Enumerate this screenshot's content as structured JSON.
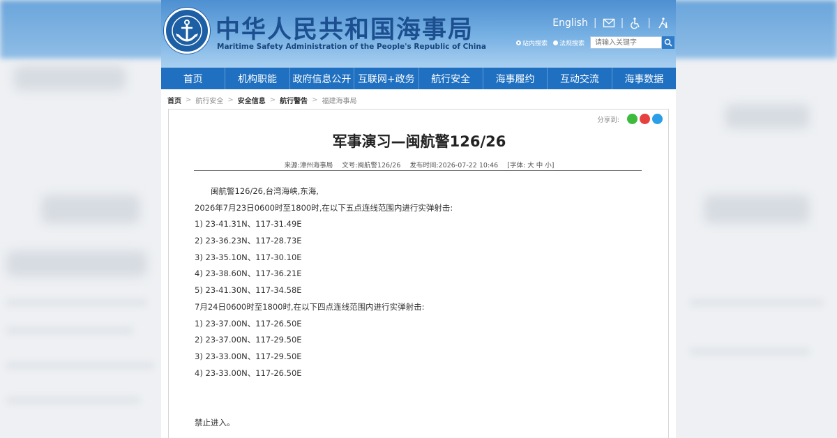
{
  "colors": {
    "brand_blue": "#1f70c1",
    "header_top": "#4d8fd1",
    "header_bottom": "#a9cff0",
    "title_navy": "#1c4f8f"
  },
  "header": {
    "logo_icon": "anchor-emblem-icon",
    "title": "中华人民共和国海事局",
    "subtitle": "Maritime Safety Administration of the People's Republic of China",
    "english_link": "English",
    "icons": [
      "mail-icon",
      "accessibility-icon",
      "elder-mode-icon"
    ]
  },
  "search": {
    "option_site": "站内搜索",
    "option_regs": "法规搜索",
    "placeholder": "请输入关键字",
    "button_icon": "search-icon"
  },
  "nav": {
    "items": [
      "首页",
      "机构职能",
      "政府信息公开",
      "互联网+政务",
      "航行安全",
      "海事履约",
      "互动交流",
      "海事数据"
    ]
  },
  "breadcrumb": [
    "首页",
    "航行安全",
    "安全信息",
    "航行警告",
    "福建海事局"
  ],
  "share": {
    "label": "分享到:",
    "icons": [
      "wechat-icon",
      "weibo-icon",
      "qq-icon"
    ]
  },
  "article": {
    "title": "军事演习—闽航警126/26",
    "meta": {
      "source": "来源:漳州海事局",
      "doc_no": "文号:闽航警126/26",
      "published": "发布时间:2026-07-22 10:46",
      "font_size": "[字体: 大 中 小]"
    },
    "lines": [
      "闽航警126/26,台湾海峡,东海,",
      "2026年7月23日0600时至1800时,在以下五点连线范围内进行实弹射击:",
      "1) 23-41.31N、117-31.49E",
      "2) 23-36.23N、117-28.73E",
      "3) 23-35.10N、117-30.10E",
      "4) 23-38.60N、117-36.21E",
      "5) 23-41.30N、117-34.58E",
      "7月24日0600时至1800时,在以下四点连线范围内进行实弹射击:",
      "1) 23-37.00N、117-26.50E",
      "2) 23-37.00N、117-29.50E",
      "3) 23-33.00N、117-29.50E",
      "4) 23-33.00N、117-26.50E"
    ],
    "closing": "禁止进入。"
  }
}
